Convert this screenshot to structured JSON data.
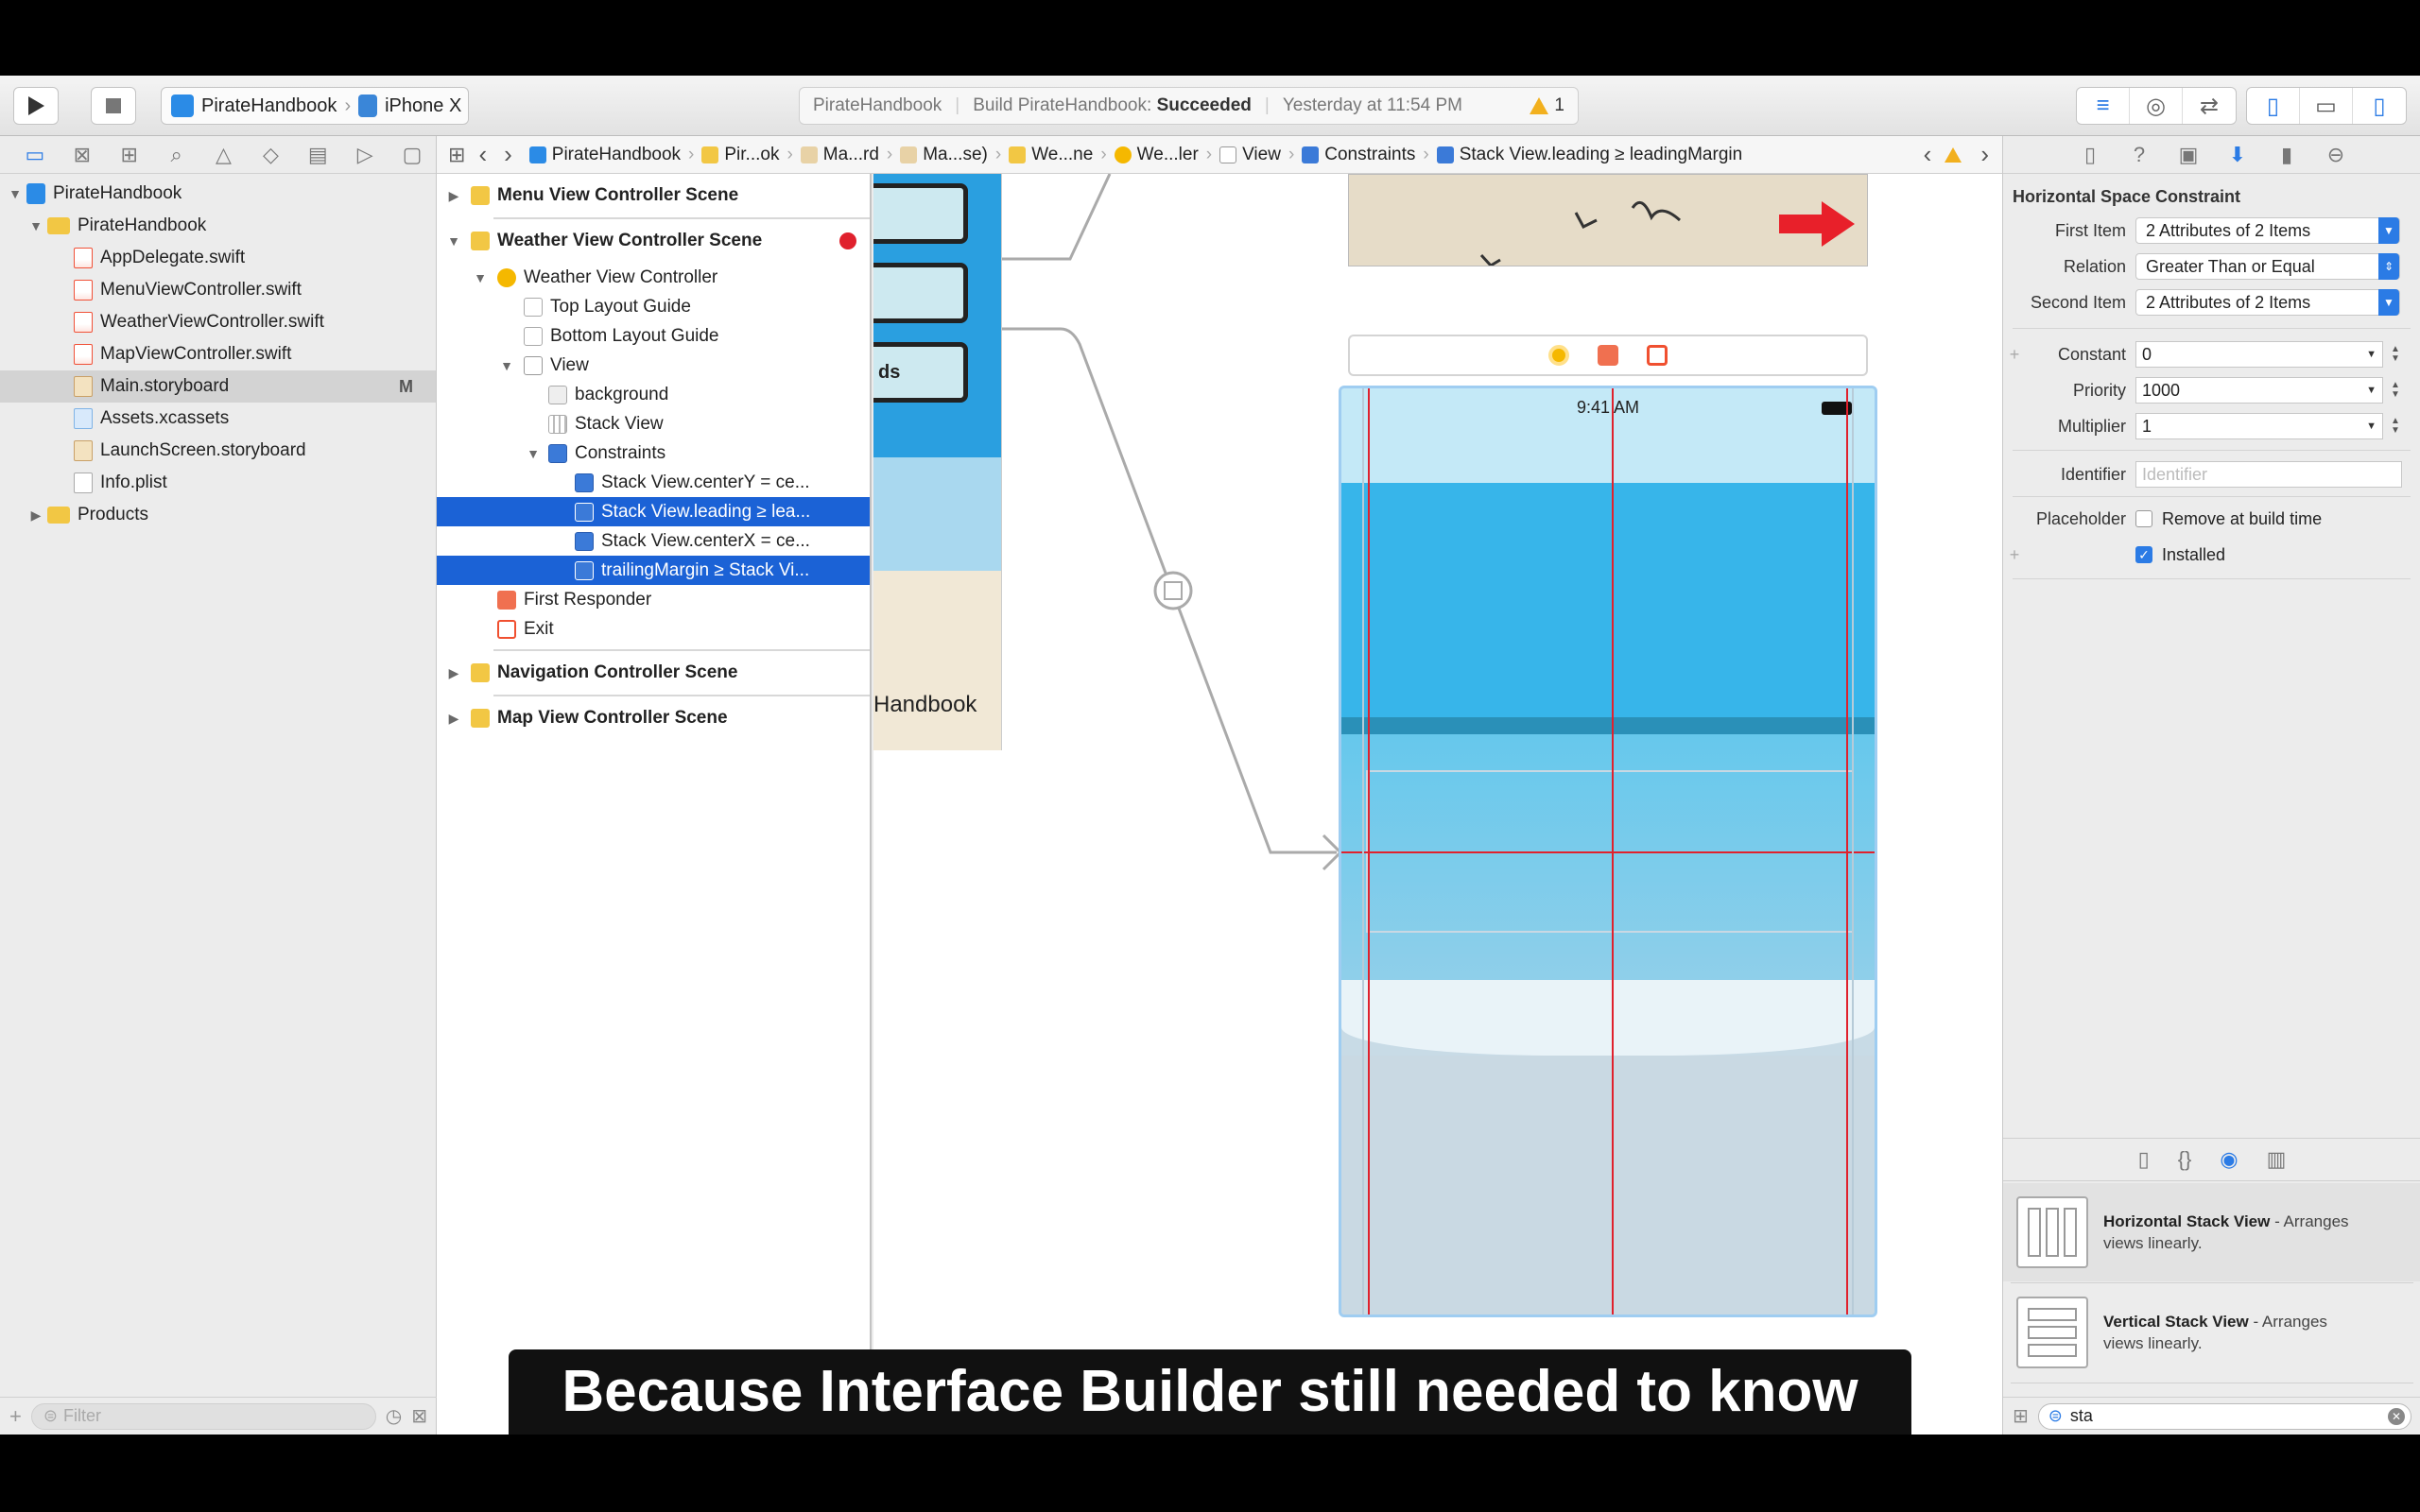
{
  "toolbar": {
    "scheme": "PirateHandbook",
    "device": "iPhone X",
    "activity_project": "PirateHandbook",
    "activity_build_prefix": "Build PirateHandbook:",
    "activity_build_status": "Succeeded",
    "activity_time": "Yesterday at 11:54 PM",
    "warning_count": "1"
  },
  "navigator": {
    "items": [
      {
        "label": "PirateHandbook"
      },
      {
        "label": "PirateHandbook"
      },
      {
        "label": "AppDelegate.swift"
      },
      {
        "label": "MenuViewController.swift"
      },
      {
        "label": "WeatherViewController.swift"
      },
      {
        "label": "MapViewController.swift"
      },
      {
        "label": "Main.storyboard",
        "badge": "M"
      },
      {
        "label": "Assets.xcassets"
      },
      {
        "label": "LaunchScreen.storyboard"
      },
      {
        "label": "Info.plist"
      },
      {
        "label": "Products"
      }
    ],
    "filter_placeholder": "Filter"
  },
  "jumpbar": {
    "items": [
      "PirateHandbook",
      "Pir...ok",
      "Ma...rd",
      "Ma...se)",
      "We...ne",
      "We...ler",
      "View",
      "Constraints",
      "Stack View.leading ≥ leadingMargin"
    ]
  },
  "outline": {
    "rows": [
      {
        "label": "Menu View Controller Scene"
      },
      {
        "label": "Weather View Controller Scene"
      },
      {
        "label": "Weather View Controller"
      },
      {
        "label": "Top Layout Guide"
      },
      {
        "label": "Bottom Layout Guide"
      },
      {
        "label": "View"
      },
      {
        "label": "background"
      },
      {
        "label": "Stack View"
      },
      {
        "label": "Constraints"
      },
      {
        "label": "Stack View.centerY = ce..."
      },
      {
        "label": "Stack View.leading ≥ lea..."
      },
      {
        "label": "Stack View.centerX = ce..."
      },
      {
        "label": "trailingMargin ≥ Stack Vi..."
      },
      {
        "label": "First Responder"
      },
      {
        "label": "Exit"
      },
      {
        "label": "Navigation Controller Scene"
      },
      {
        "label": "Map View Controller Scene"
      }
    ]
  },
  "canvas": {
    "menu_scene_text": "Handbook",
    "button_fragment": "ds",
    "status_time": "9:41 AM"
  },
  "inspector": {
    "title": "Horizontal Space Constraint",
    "first_item_label": "First Item",
    "first_item_value": "2 Attributes of 2 Items",
    "relation_label": "Relation",
    "relation_value": "Greater Than or Equal",
    "second_item_label": "Second Item",
    "second_item_value": "2 Attributes of 2 Items",
    "constant_label": "Constant",
    "constant_value": "0",
    "priority_label": "Priority",
    "priority_value": "1000",
    "multiplier_label": "Multiplier",
    "multiplier_value": "1",
    "identifier_label": "Identifier",
    "identifier_placeholder": "Identifier",
    "placeholder_label": "Placeholder",
    "remove_label": "Remove at build time",
    "installed_label": "Installed",
    "library": [
      {
        "name": "Horizontal Stack View",
        "desc_line1": "- Arranges",
        "desc_line2": "views linearly."
      },
      {
        "name": "Vertical Stack View",
        "desc_line1": "- Arranges",
        "desc_line2": "views linearly."
      }
    ],
    "library_search": "sta"
  },
  "subtitle": "Because Interface Builder still needed to know",
  "colors": {
    "accent": "#2b7be5",
    "selection": "#1b62d6",
    "constraint": "#e0212d",
    "sky": "#4bbbe9"
  }
}
